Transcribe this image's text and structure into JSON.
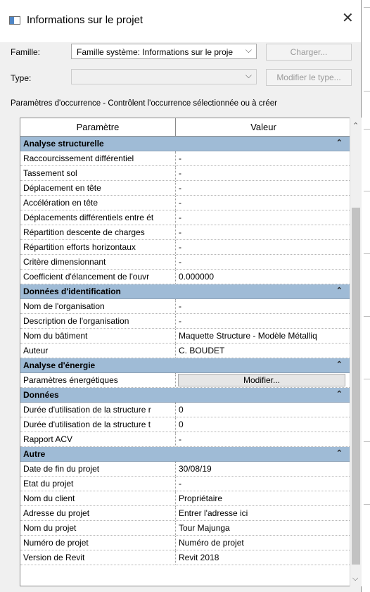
{
  "window": {
    "title": "Informations sur le projet",
    "close_glyph": "✕"
  },
  "form": {
    "famille_label": "Famille:",
    "famille_value": "Famille système: Informations sur le proje",
    "type_label": "Type:",
    "type_value": "",
    "charger_label": "Charger...",
    "modifier_type_label": "Modifier le type..."
  },
  "section_caption": "Paramètres d'occurrence - Contrôlent l'occurrence sélectionnée ou à créer",
  "table": {
    "col_parametre": "Paramètre",
    "col_valeur": "Valeur",
    "collapse_glyph": "⌃",
    "groups": [
      {
        "title": "Analyse structurelle",
        "rows": [
          {
            "p": "Raccourcissement différentiel",
            "v": "-"
          },
          {
            "p": "Tassement sol",
            "v": "-"
          },
          {
            "p": "Déplacement en tête",
            "v": "-"
          },
          {
            "p": "Accélération en tête",
            "v": "-"
          },
          {
            "p": "Déplacements différentiels entre ét",
            "v": "-"
          },
          {
            "p": "Répartition descente de charges",
            "v": "-"
          },
          {
            "p": "Répartition efforts horizontaux",
            "v": "-"
          },
          {
            "p": "Critère dimensionnant",
            "v": "-"
          },
          {
            "p": "Coefficient d'élancement de l'ouvr",
            "v": "0.000000"
          }
        ]
      },
      {
        "title": "Données d'identification",
        "rows": [
          {
            "p": "Nom de l'organisation",
            "v": "-"
          },
          {
            "p": "Description de l'organisation",
            "v": "-"
          },
          {
            "p": "Nom du bâtiment",
            "v": "Maquette Structure - Modèle Métalliq"
          },
          {
            "p": "Auteur",
            "v": "C. BOUDET"
          }
        ]
      },
      {
        "title": "Analyse d'énergie",
        "rows": [
          {
            "p": "Paramètres énergétiques",
            "v": "Modifier...",
            "button": true
          }
        ]
      },
      {
        "title": "Données",
        "rows": [
          {
            "p": "Durée d'utilisation de la structure r",
            "v": "0"
          },
          {
            "p": "Durée d'utilisation de la structure t",
            "v": "0"
          },
          {
            "p": "Rapport ACV",
            "v": "-"
          }
        ]
      },
      {
        "title": "Autre",
        "rows": [
          {
            "p": "Date de fin du projet",
            "v": "30/08/19"
          },
          {
            "p": "Etat du projet",
            "v": "-"
          },
          {
            "p": "Nom du client",
            "v": "Propriétaire"
          },
          {
            "p": "Adresse du projet",
            "v": "Entrer l'adresse ici"
          },
          {
            "p": "Nom du projet",
            "v": "Tour Majunga"
          },
          {
            "p": "Numéro de projet",
            "v": "Numéro de projet"
          },
          {
            "p": "Version de Revit",
            "v": "Revit 2018"
          }
        ]
      }
    ]
  },
  "colors": {
    "group_header": "#9fbbd6",
    "dialog_bg": "#f0f0f0"
  }
}
